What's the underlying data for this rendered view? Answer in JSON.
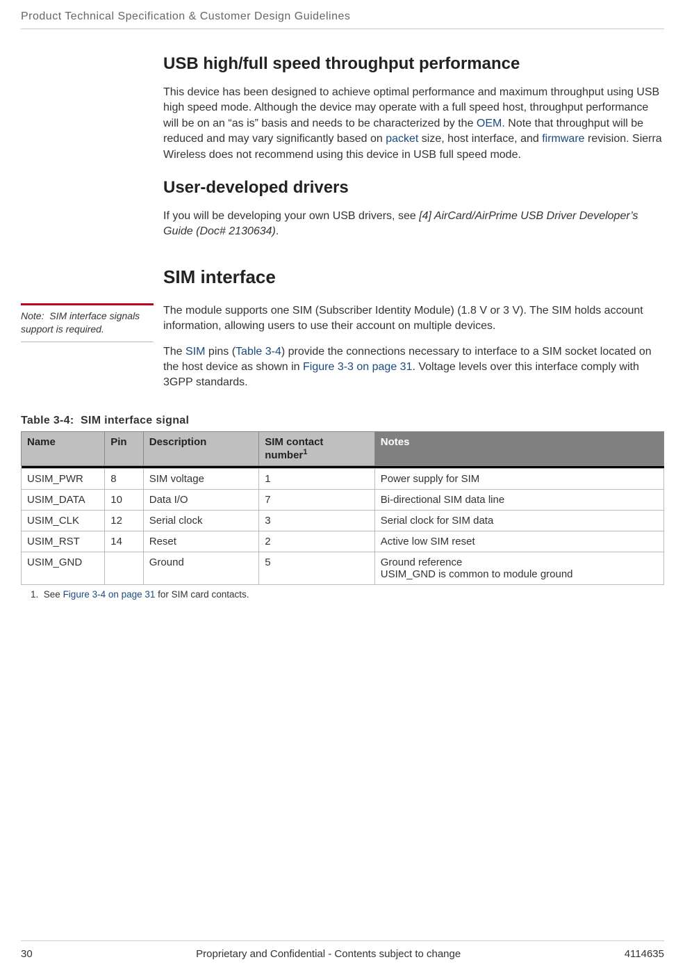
{
  "header": {
    "running_title": "Product Technical Specification & Customer Design Guidelines"
  },
  "usb_section": {
    "title": "USB high/full speed throughput performance",
    "para_part1": "This device has been designed to achieve optimal performance and maximum throughput using USB high speed mode. Although the device may operate with a full speed host, throughput performance will be on an “as is” basis and needs to be characterized by the ",
    "link_oem": "OEM",
    "para_part2": ". Note that throughput will be reduced and may vary significantly based on ",
    "link_packet": "packet",
    "para_part3": " size, host interface, and ",
    "link_firmware": "firmware",
    "para_part4": " revision. Sierra Wireless does not recommend using this device in USB full speed mode."
  },
  "drivers_section": {
    "title": "User-developed drivers",
    "para_part1": "If you will be developing your own USB drivers, see ",
    "ref_italic": "[4] AirCard/AirPrime USB Driver Developer’s Guide (Doc# 2130634)",
    "para_part2": "."
  },
  "sim_section": {
    "title": "SIM interface",
    "note_label": "Note:  SIM interface signals support is required.",
    "para1": "The module supports one SIM (Subscriber Identity Module) (1.8 V or 3 V). The SIM holds account information, allowing users to use their account on multiple devices.",
    "para2_part1": "The ",
    "link_sim": "SIM",
    "para2_part2": " pins (",
    "link_table34": "Table 3-4",
    "para2_part3": ") provide the connections necessary to interface to a SIM socket located on the host device as shown in ",
    "link_fig33": "Figure 3-3 on page 31",
    "para2_part4": ". Voltage levels over this interface comply with 3GPP standards."
  },
  "table": {
    "caption": "Table 3-4:  SIM interface signal",
    "headers": {
      "name": "Name",
      "pin": "Pin",
      "description": "Description",
      "contact_prefix": "SIM contact number",
      "contact_sup": "1",
      "notes": "Notes"
    },
    "rows": [
      {
        "name": "USIM_PWR",
        "pin": "8",
        "desc": "SIM voltage",
        "contact": "1",
        "notes": "Power supply for SIM"
      },
      {
        "name": "USIM_DATA",
        "pin": "10",
        "desc": "Data I/O",
        "contact": "7",
        "notes": "Bi-directional SIM data line"
      },
      {
        "name": "USIM_CLK",
        "pin": "12",
        "desc": "Serial clock",
        "contact": "3",
        "notes": "Serial clock for SIM data"
      },
      {
        "name": "USIM_RST",
        "pin": "14",
        "desc": "Reset",
        "contact": "2",
        "notes": "Active low SIM reset"
      },
      {
        "name": "USIM_GND",
        "pin": "",
        "desc": "Ground",
        "contact": "5",
        "notes": "Ground reference\nUSIM_GND is common to module ground"
      }
    ],
    "footnote_num": "1.",
    "footnote_prefix": "See ",
    "footnote_link": "Figure 3-4 on page 31",
    "footnote_suffix": " for SIM card contacts."
  },
  "footer": {
    "page_num": "30",
    "center": "Proprietary and Confidential - Contents subject to change",
    "doc_num": "4114635"
  }
}
